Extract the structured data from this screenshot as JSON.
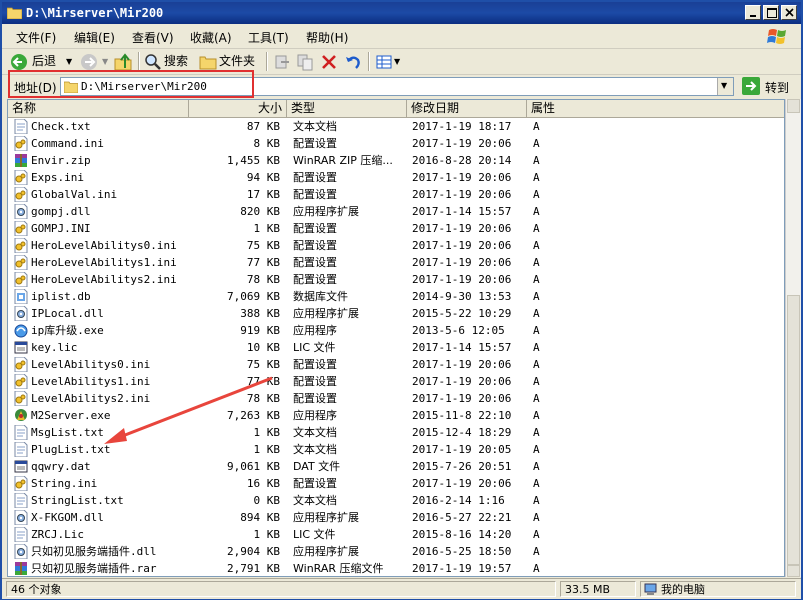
{
  "window": {
    "title": "D:\\Mirserver\\Mir200"
  },
  "menu": [
    "文件(F)",
    "编辑(E)",
    "查看(V)",
    "收藏(A)",
    "工具(T)",
    "帮助(H)"
  ],
  "toolbar": {
    "back": "后退",
    "search": "搜索",
    "folders": "文件夹"
  },
  "address": {
    "label": "地址(D)",
    "value": "D:\\Mirserver\\Mir200",
    "go": "转到"
  },
  "columns": {
    "name": "名称",
    "size": "大小",
    "type": "类型",
    "modified": "修改日期",
    "attr": "属性"
  },
  "files": [
    {
      "name": "Check.txt",
      "size": "87 KB",
      "type": "文本文档",
      "date": "2017-1-19 18:17",
      "attr": "A",
      "icon": "txt"
    },
    {
      "name": "Command.ini",
      "size": "8 KB",
      "type": "配置设置",
      "date": "2017-1-19 20:06",
      "attr": "A",
      "icon": "ini"
    },
    {
      "name": "Envir.zip",
      "size": "1,455 KB",
      "type": "WinRAR ZIP 压缩...",
      "date": "2016-8-28 20:14",
      "attr": "A",
      "icon": "rar"
    },
    {
      "name": "Exps.ini",
      "size": "94 KB",
      "type": "配置设置",
      "date": "2017-1-19 20:06",
      "attr": "A",
      "icon": "ini"
    },
    {
      "name": "GlobalVal.ini",
      "size": "17 KB",
      "type": "配置设置",
      "date": "2017-1-19 20:06",
      "attr": "A",
      "icon": "ini"
    },
    {
      "name": "gompj.dll",
      "size": "820 KB",
      "type": "应用程序扩展",
      "date": "2017-1-14 15:57",
      "attr": "A",
      "icon": "dll"
    },
    {
      "name": "GOMPJ.INI",
      "size": "1 KB",
      "type": "配置设置",
      "date": "2017-1-19 20:06",
      "attr": "A",
      "icon": "ini"
    },
    {
      "name": "HeroLevelAbilitys0.ini",
      "size": "75 KB",
      "type": "配置设置",
      "date": "2017-1-19 20:06",
      "attr": "A",
      "icon": "ini"
    },
    {
      "name": "HeroLevelAbilitys1.ini",
      "size": "77 KB",
      "type": "配置设置",
      "date": "2017-1-19 20:06",
      "attr": "A",
      "icon": "ini"
    },
    {
      "name": "HeroLevelAbilitys2.ini",
      "size": "78 KB",
      "type": "配置设置",
      "date": "2017-1-19 20:06",
      "attr": "A",
      "icon": "ini"
    },
    {
      "name": "iplist.db",
      "size": "7,069 KB",
      "type": "数据库文件",
      "date": "2014-9-30 13:53",
      "attr": "A",
      "icon": "db"
    },
    {
      "name": "IPLocal.dll",
      "size": "388 KB",
      "type": "应用程序扩展",
      "date": "2015-5-22 10:29",
      "attr": "A",
      "icon": "dll"
    },
    {
      "name": "ip库升级.exe",
      "size": "919 KB",
      "type": "应用程序",
      "date": "2013-5-6 12:05",
      "attr": "A",
      "icon": "exe-ie"
    },
    {
      "name": "key.lic",
      "size": "10 KB",
      "type": "LIC 文件",
      "date": "2017-1-14 15:57",
      "attr": "A",
      "icon": "lic"
    },
    {
      "name": "LevelAbilitys0.ini",
      "size": "75 KB",
      "type": "配置设置",
      "date": "2017-1-19 20:06",
      "attr": "A",
      "icon": "ini"
    },
    {
      "name": "LevelAbilitys1.ini",
      "size": "77 KB",
      "type": "配置设置",
      "date": "2017-1-19 20:06",
      "attr": "A",
      "icon": "ini"
    },
    {
      "name": "LevelAbilitys2.ini",
      "size": "78 KB",
      "type": "配置设置",
      "date": "2017-1-19 20:06",
      "attr": "A",
      "icon": "ini"
    },
    {
      "name": "M2Server.exe",
      "size": "7,263 KB",
      "type": "应用程序",
      "date": "2015-11-8 22:10",
      "attr": "A",
      "icon": "exe-m2"
    },
    {
      "name": "MsgList.txt",
      "size": "1 KB",
      "type": "文本文档",
      "date": "2015-12-4 18:29",
      "attr": "A",
      "icon": "txt"
    },
    {
      "name": "PlugList.txt",
      "size": "1 KB",
      "type": "文本文档",
      "date": "2017-1-19 20:05",
      "attr": "A",
      "icon": "txt"
    },
    {
      "name": "qqwry.dat",
      "size": "9,061 KB",
      "type": "DAT 文件",
      "date": "2015-7-26 20:51",
      "attr": "A",
      "icon": "lic"
    },
    {
      "name": "String.ini",
      "size": "16 KB",
      "type": "配置设置",
      "date": "2017-1-19 20:06",
      "attr": "A",
      "icon": "ini"
    },
    {
      "name": "StringList.txt",
      "size": "0 KB",
      "type": "文本文档",
      "date": "2016-2-14 1:16",
      "attr": "A",
      "icon": "txt"
    },
    {
      "name": "X-FKGOM.dll",
      "size": "894 KB",
      "type": "应用程序扩展",
      "date": "2016-5-27 22:21",
      "attr": "A",
      "icon": "dll"
    },
    {
      "name": "ZRCJ.Lic",
      "size": "1 KB",
      "type": "LIC 文件",
      "date": "2015-8-16 14:20",
      "attr": "A",
      "icon": "txt"
    },
    {
      "name": "只如初见服务端插件.dll",
      "size": "2,904 KB",
      "type": "应用程序扩展",
      "date": "2016-5-25 18:50",
      "attr": "A",
      "icon": "dll"
    },
    {
      "name": "只如初见服务端插件.rar",
      "size": "2,791 KB",
      "type": "WinRAR 压缩文件",
      "date": "2017-1-19 19:57",
      "attr": "A",
      "icon": "rar"
    }
  ],
  "status": {
    "count": "46 个对象",
    "size": "33.5 MB",
    "location": "我的电脑"
  },
  "colors": {
    "title_bar": "#1c4aa6",
    "highlight": "#e03030",
    "arrow": "#e8453c"
  }
}
